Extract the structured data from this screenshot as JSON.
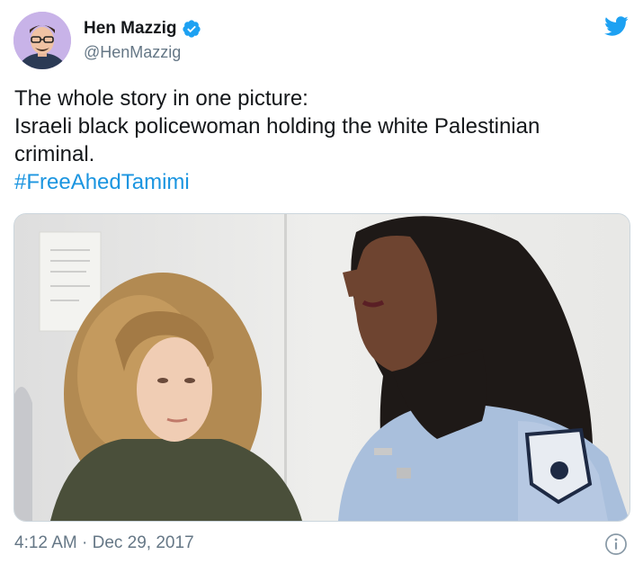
{
  "author": {
    "name": "Hen Mazzig",
    "handle": "@HenMazzig",
    "verified_icon": "verified-badge-icon",
    "avatar_icon": "avatar"
  },
  "platform_icon": "twitter-bird-icon",
  "tweet": {
    "lines": [
      "The whole story in one picture:",
      "Israeli black policewoman holding the white Palestinian",
      "criminal."
    ],
    "hashtag": "#FreeAhedTamimi"
  },
  "timestamp": {
    "time": "4:12 AM",
    "separator": "·",
    "date": "Dec 29, 2017"
  },
  "footer_icon": "info-icon",
  "colors": {
    "link": "#1b95e0",
    "twitter_blue": "#1da1f2",
    "secondary_text": "#657786"
  }
}
